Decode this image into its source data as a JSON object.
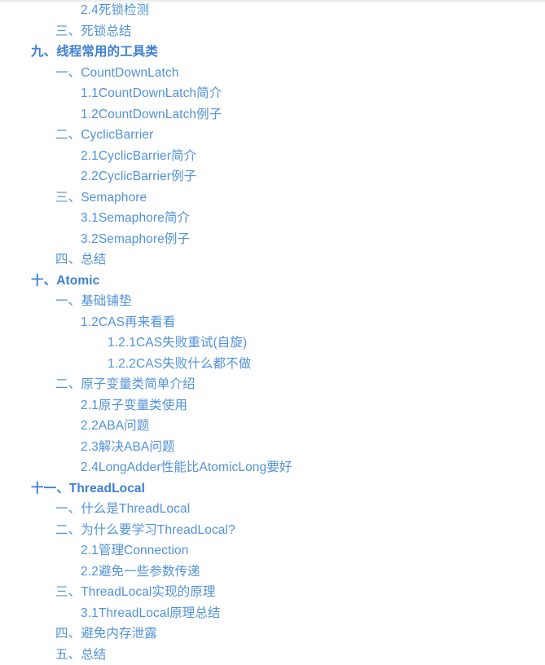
{
  "page": {
    "background_color": "#ffffff",
    "link_color": "#5192d8",
    "heading_color": "#3d7fd4"
  },
  "toc": {
    "items": [
      {
        "label": "2.4死锁检测",
        "level": 3
      },
      {
        "label": "三、死锁总结",
        "level": 2
      },
      {
        "label": "九、线程常用的工具类",
        "level": 1
      },
      {
        "label": "一、CountDownLatch",
        "level": 2
      },
      {
        "label": "1.1CountDownLatch简介",
        "level": 3
      },
      {
        "label": "1.2CountDownLatch例子",
        "level": 3
      },
      {
        "label": "二、CyclicBarrier",
        "level": 2
      },
      {
        "label": "2.1CyclicBarrier简介",
        "level": 3
      },
      {
        "label": "2.2CyclicBarrier例子",
        "level": 3
      },
      {
        "label": "三、Semaphore",
        "level": 2
      },
      {
        "label": "3.1Semaphore简介",
        "level": 3
      },
      {
        "label": "3.2Semaphore例子",
        "level": 3
      },
      {
        "label": "四、总结",
        "level": 2
      },
      {
        "label": "十、Atomic",
        "level": 1
      },
      {
        "label": "一、基础铺垫",
        "level": 2
      },
      {
        "label": "1.2CAS再来看看",
        "level": 3
      },
      {
        "label": "1.2.1CAS失败重试(自旋)",
        "level": 4
      },
      {
        "label": "1.2.2CAS失败什么都不做",
        "level": 4
      },
      {
        "label": "二、原子变量类简单介绍",
        "level": 2
      },
      {
        "label": "2.1原子变量类使用",
        "level": 3
      },
      {
        "label": "2.2ABA问题",
        "level": 3
      },
      {
        "label": "2.3解决ABA问题",
        "level": 3
      },
      {
        "label": "2.4LongAdder性能比AtomicLong要好",
        "level": 3
      },
      {
        "label": "十一、ThreadLocal",
        "level": 1
      },
      {
        "label": "一、什么是ThreadLocal",
        "level": 2
      },
      {
        "label": "二、为什么要学习ThreadLocal?",
        "level": 2
      },
      {
        "label": "2.1管理Connection",
        "level": 3
      },
      {
        "label": "2.2避免一些参数传递",
        "level": 3
      },
      {
        "label": "三、ThreadLocal实现的原理",
        "level": 2
      },
      {
        "label": "3.1ThreadLocal原理总结",
        "level": 3
      },
      {
        "label": "四、避免内存泄露",
        "level": 2
      },
      {
        "label": "五、总结",
        "level": 2
      }
    ]
  }
}
